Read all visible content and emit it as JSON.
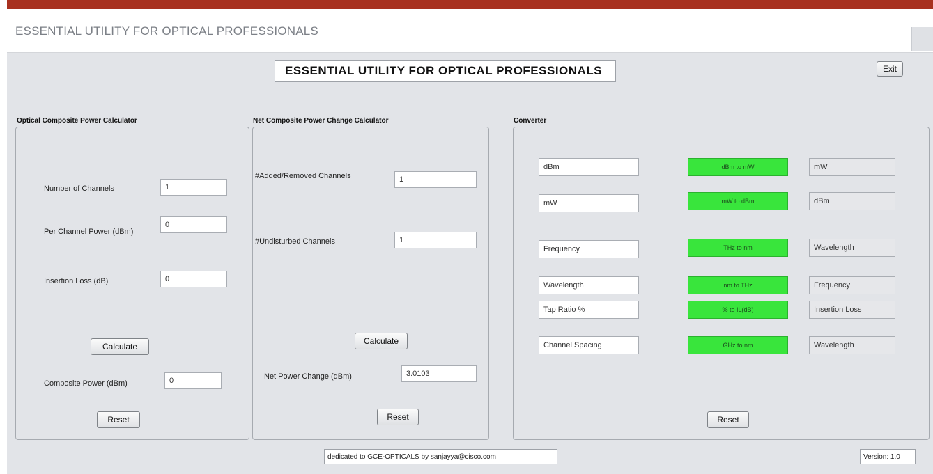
{
  "window": {
    "title": "ESSENTIAL UTILITY FOR OPTICAL PROFESSIONALS"
  },
  "header": {
    "banner": "ESSENTIAL UTILITY FOR OPTICAL PROFESSIONALS",
    "exit_label": "Exit"
  },
  "composite": {
    "title": "Optical Composite Power Calculator",
    "channels_label": "Number of Channels",
    "channels_value": "1",
    "per_channel_label": "Per Channel Power (dBm)",
    "per_channel_value": "0",
    "insertion_label": "Insertion Loss (dB)",
    "insertion_value": "0",
    "calculate_label": "Calculate",
    "result_label": "Composite Power (dBm)",
    "result_value": "0",
    "reset_label": "Reset"
  },
  "net": {
    "title": "Net Composite Power Change Calculator",
    "added_label": "#Added/Removed Channels",
    "added_value": "1",
    "undisturbed_label": "#Undisturbed Channels",
    "undisturbed_value": "1",
    "calculate_label": "Calculate",
    "result_label": "Net Power Change (dBm)",
    "result_value": "3.0103",
    "reset_label": "Reset"
  },
  "converter": {
    "title": "Converter",
    "rows": [
      {
        "input": "dBm",
        "button": "dBm to mW",
        "output": "mW"
      },
      {
        "input": "mW",
        "button": "mW to dBm",
        "output": "dBm"
      },
      {
        "input": "Frequency",
        "button": "THz to nm",
        "output": "Wavelength"
      },
      {
        "input": "Wavelength",
        "button": "nm to THz",
        "output": "Frequency"
      },
      {
        "input": "Tap Ratio %",
        "button": "% to IL(dB)",
        "output": "Insertion Loss"
      },
      {
        "input": "Channel Spacing",
        "button": "GHz to nm",
        "output": "Wavelength"
      }
    ],
    "reset_label": "Reset"
  },
  "footer": {
    "dedication": "dedicated to GCE-OPTICALS by sanjayya@cisco.com",
    "version": "Version: 1.0"
  },
  "colors": {
    "frame_accent": "#a8311f",
    "client_bg": "#e2e4e8",
    "convert_button": "#39e53c"
  }
}
